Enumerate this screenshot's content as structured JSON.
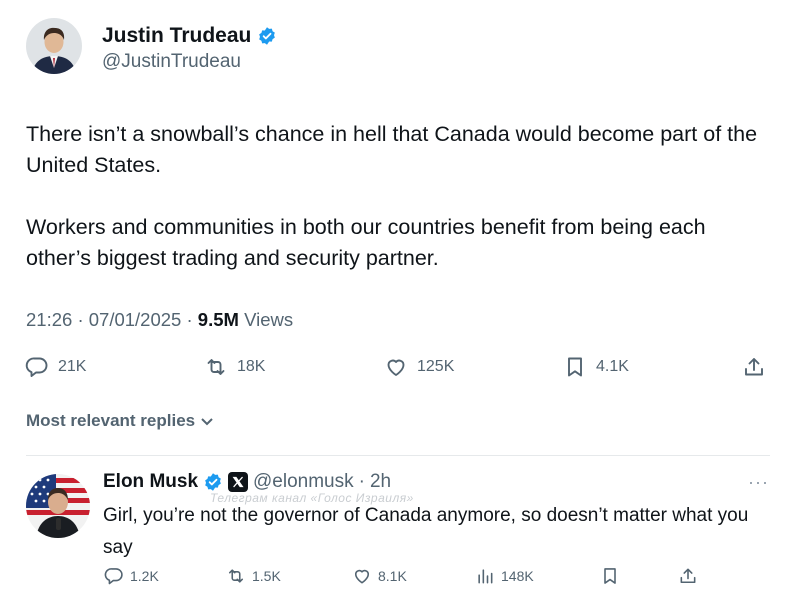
{
  "tweet": {
    "author": {
      "display_name": "Justin Trudeau",
      "handle": "@JustinTrudeau",
      "verified": true
    },
    "text": [
      "There isn’t a snowball’s chance in hell that Canada would become part of the United States.",
      "Workers and communities in both our countries benefit from being each other’s biggest trading and security partner."
    ],
    "time": "21:26",
    "date": "07/01/2025",
    "views_count": "9.5M",
    "views_label": "Views",
    "stats": {
      "replies": "21K",
      "reposts": "18K",
      "likes": "125K",
      "bookmarks": "4.1K"
    }
  },
  "replies_sort": {
    "label": "Most relevant replies"
  },
  "reply": {
    "author": {
      "display_name": "Elon Musk",
      "handle": "@elonmusk",
      "verified": true
    },
    "time": "2h",
    "separator": "·",
    "more": "···",
    "watermark": "Телеграм канал «Голос Израиля»",
    "text": "Girl, you’re not the governor of Canada anymore, so doesn’t matter what you say",
    "stats": {
      "replies": "1.2K",
      "reposts": "1.5K",
      "likes": "8.1K",
      "views": "148K"
    }
  },
  "icons": {
    "verified": "verified-badge-icon",
    "reply": "speech-bubble-icon",
    "repost": "repost-arrows-icon",
    "like": "heart-icon",
    "bookmark": "bookmark-icon",
    "share": "share-upload-icon",
    "views": "bar-chart-icon",
    "sort": "chevron-down-icon",
    "x_badge": "x-logo-icon"
  },
  "colors": {
    "verified_blue": "#1d9bf0",
    "text_primary": "#0f1419",
    "text_secondary": "#536471"
  }
}
